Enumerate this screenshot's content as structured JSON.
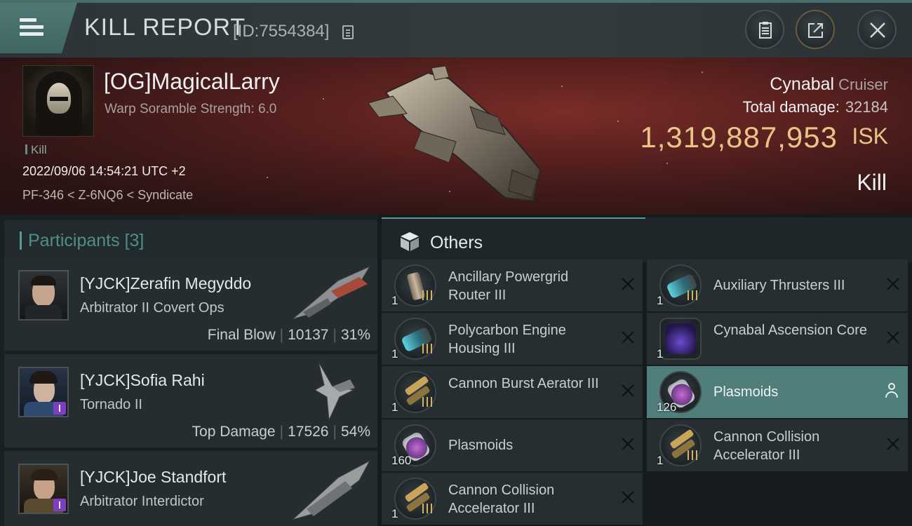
{
  "header": {
    "title": "KILL REPORT",
    "report_id": "[ID:7554384]"
  },
  "victim": {
    "name": "[OG]MagicalLarry",
    "warp_scramble": "Warp Soramble Strength: 6.0",
    "tag": "Kill",
    "datetime": "2022/09/06 14:54:21 UTC +2",
    "location": "PF-346 < Z-6NQ6 < Syndicate",
    "ship": "Cynabal",
    "ship_class": "Cruiser",
    "total_damage_label": "Total damage:",
    "total_damage": "32184",
    "isk_value": "1,319,887,953",
    "isk_unit": "ISK",
    "result": "Kill"
  },
  "participants": {
    "title": "Participants",
    "count": "[3]",
    "rows": [
      {
        "name": "[YJCK]Zerafin Megyddo",
        "ship": "Arbitrator II Covert Ops",
        "stat_label": "Final Blow",
        "damage": "10137",
        "percent": "31%"
      },
      {
        "name": "[YJCK]Sofia Rahi",
        "ship": "Tornado II",
        "stat_label": "Top Damage",
        "damage": "17526",
        "percent": "54%"
      },
      {
        "name": "[YJCK]Joe Standfort",
        "ship": "Arbitrator Interdictor"
      }
    ]
  },
  "others": {
    "title": "Others",
    "left_items": [
      {
        "name": "Ancillary Powergrid Router III",
        "qty": "1",
        "icon": "battery-icon"
      },
      {
        "name": "Polycarbon Engine Housing III",
        "qty": "1",
        "icon": "thruster-icon"
      },
      {
        "name": "Cannon Burst Aerator III",
        "qty": "1",
        "icon": "ammo-icon"
      },
      {
        "name": "Plasmoids",
        "qty": "160",
        "icon": "plasmoid-icon"
      },
      {
        "name": "Cannon Collision Accelerator III",
        "qty": "1",
        "icon": "ammo-icon"
      }
    ],
    "right_items": [
      {
        "name": "Auxiliary Thrusters III",
        "qty": "1",
        "icon": "thruster-icon"
      },
      {
        "name": "Cynabal Ascension Core",
        "qty": "1",
        "icon": "core-icon"
      },
      {
        "name": "Plasmoids",
        "qty": "126",
        "icon": "plasmoid-icon",
        "selected": true
      },
      {
        "name": "Cannon Collision Accelerator III",
        "qty": "1",
        "icon": "ammo-icon"
      }
    ]
  },
  "colors": {
    "accent_teal": "#4f7e7a",
    "isk_gold": "#e8c586",
    "selected_row": "#4f7e7b"
  }
}
